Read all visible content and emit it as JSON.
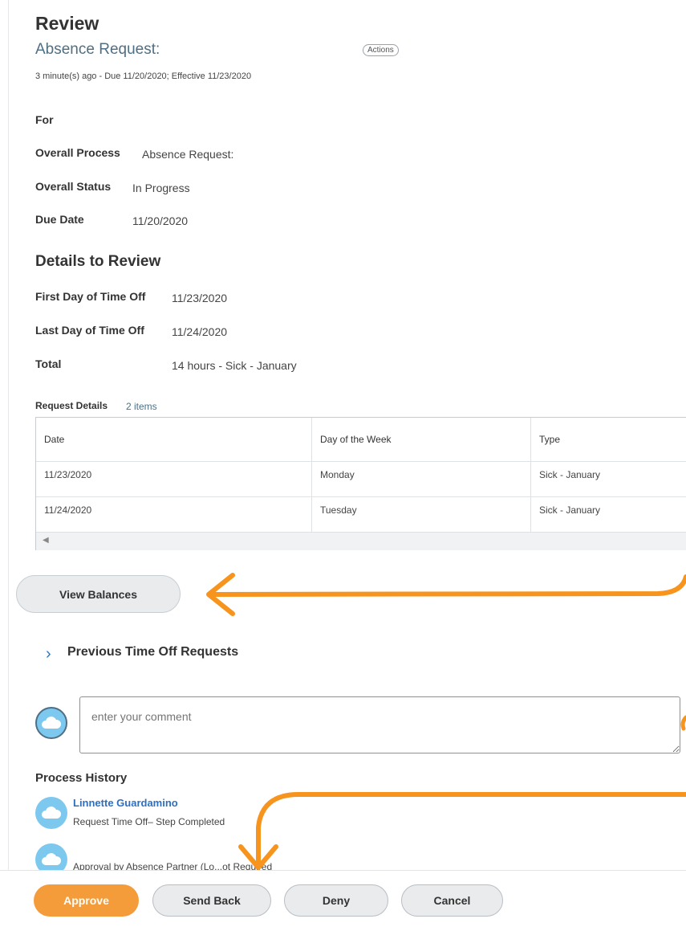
{
  "header": {
    "title": "Review",
    "subtitle": "Absence Request:",
    "actions_label": "Actions",
    "meta": "3 minute(s) ago - Due 11/20/2020; Effective 11/23/2020"
  },
  "summary": {
    "for_label": "For",
    "process_label": "Overall Process",
    "process_value": "Absence Request:",
    "status_label": "Overall Status",
    "status_value": "In Progress",
    "due_label": "Due Date",
    "due_value": "11/20/2020"
  },
  "details": {
    "title": "Details to Review",
    "first_label": "First Day of Time Off",
    "first_value": "11/23/2020",
    "last_label": "Last Day of Time Off",
    "last_value": "11/24/2020",
    "total_label": "Total",
    "total_value": "14 hours - Sick - January"
  },
  "request_details": {
    "title": "Request Details",
    "count": "2 items",
    "columns": [
      "Date",
      "Day of the Week",
      "Type"
    ],
    "rows": [
      [
        "11/23/2020",
        "Monday",
        "Sick - January"
      ],
      [
        "11/24/2020",
        "Tuesday",
        "Sick - January"
      ]
    ]
  },
  "view_balances_label": "View Balances",
  "previous_requests_label": "Previous Time Off Requests",
  "comment": {
    "placeholder": "enter your comment"
  },
  "process_history": {
    "title": "Process History",
    "entries": [
      {
        "name": "Linnette Guardamino",
        "step": "Request Time Off– Step Completed"
      },
      {
        "step": "Approval by Absence Partner (Lo...ot Required"
      }
    ]
  },
  "footer": {
    "approve": "Approve",
    "send_back": "Send Back",
    "deny": "Deny",
    "cancel": "Cancel"
  },
  "colors": {
    "accent_orange": "#f49b3a",
    "annotation_orange": "#f7941d",
    "link_blue": "#2f6fbf",
    "avatar_blue": "#7cc8ef"
  }
}
